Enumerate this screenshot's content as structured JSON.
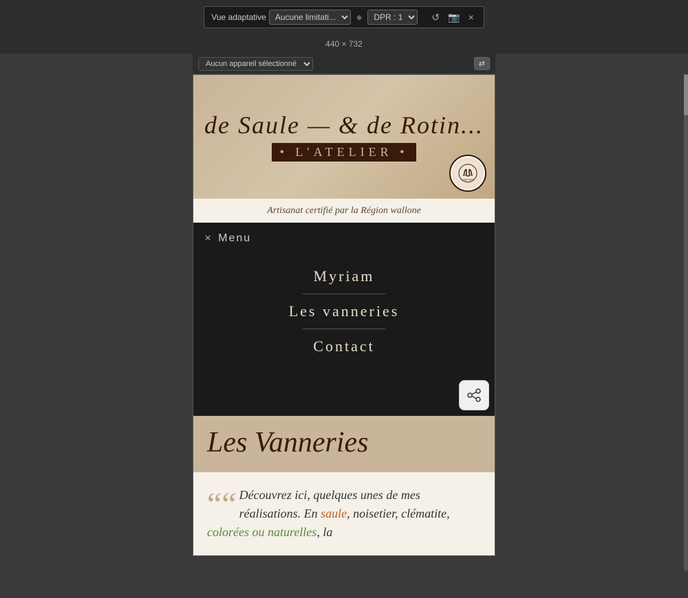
{
  "browser": {
    "toolbar": {
      "vue_adaptative_label": "Vue adaptative",
      "limitation_label": "Aucune limitati...",
      "dpr_label": "DPR : 1",
      "rotate_icon": "↺",
      "screenshot_icon": "📷",
      "close_icon": "×"
    },
    "dimensions": "440  ×  732",
    "device_selector": {
      "placeholder": "Aucun appareil sélectionné",
      "rotate_label": "⇄"
    }
  },
  "site": {
    "header": {
      "logo_line1": "de Saule — & de Rotin...",
      "logo_subtitle": "• L'ATELIER •",
      "artisan_badge_text": "ARTISAN\nCERTIFIÉ",
      "subtitle": "Artisanat certifié par la Région wallone"
    },
    "menu": {
      "close_label": "×",
      "menu_label": "Menu",
      "items": [
        {
          "label": "Myriam"
        },
        {
          "label": "Les vanneries"
        },
        {
          "label": "Contact"
        }
      ]
    },
    "share_icon": "⊙",
    "content": {
      "section_title": "Les Vanneries",
      "quote_mark": "““",
      "quote_text": "Découvrez ici, quelques unes de mes réalisations. En saule, noisetier, clématite, colorées ou naturelles, la"
    }
  }
}
